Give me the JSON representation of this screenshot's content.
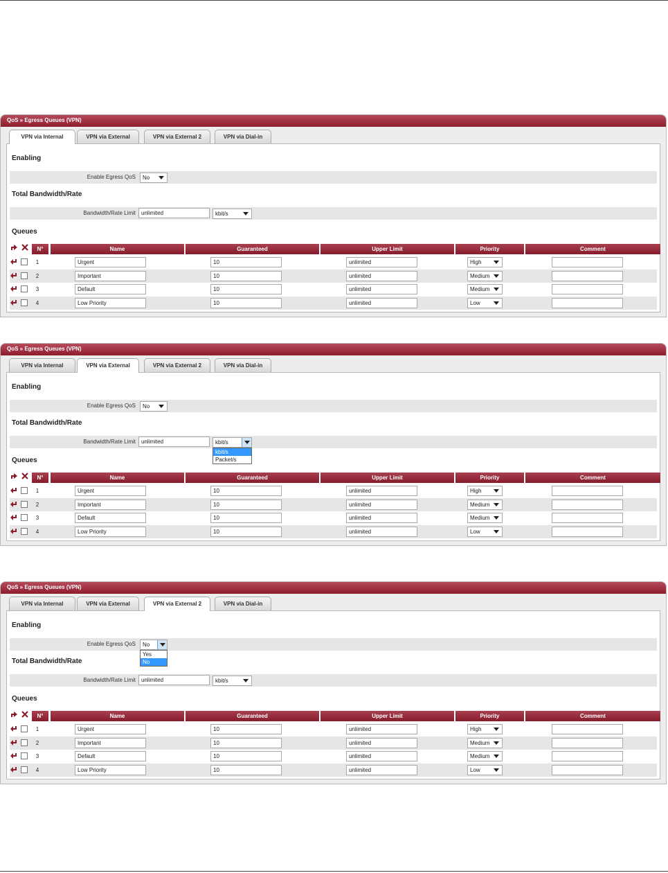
{
  "panels": [
    {
      "title": "QoS » Egress Queues (VPN)",
      "tabs": [
        "VPN via Internal",
        "VPN via External",
        "VPN via External 2",
        "VPN via Dial-in"
      ],
      "active_tab": 0,
      "sections": {
        "enabling": "Enabling",
        "bandwidth": "Total Bandwidth/Rate",
        "queues": "Queues"
      },
      "enable_label": "Enable Egress QoS",
      "enable_value": "No",
      "bandwidth_label": "Bandwidth/Rate Limit",
      "bandwidth_value": "unlimited",
      "unit_value": "kbit/s",
      "columns": [
        "N°",
        "Name",
        "Guaranteed",
        "Upper Limit",
        "Priority",
        "Comment"
      ],
      "rows": [
        {
          "n": "1",
          "name": "Urgent",
          "guaranteed": "10",
          "upper": "unlimited",
          "priority": "High",
          "comment": ""
        },
        {
          "n": "2",
          "name": "Important",
          "guaranteed": "10",
          "upper": "unlimited",
          "priority": "Medium",
          "comment": ""
        },
        {
          "n": "3",
          "name": "Default",
          "guaranteed": "10",
          "upper": "unlimited",
          "priority": "Medium",
          "comment": ""
        },
        {
          "n": "4",
          "name": "Low Priority",
          "guaranteed": "10",
          "upper": "unlimited",
          "priority": "Low",
          "comment": ""
        }
      ]
    },
    {
      "title": "QoS » Egress Queues (VPN)",
      "tabs": [
        "VPN via Internal",
        "VPN via External",
        "VPN via External 2",
        "VPN via Dial-in"
      ],
      "active_tab": 1,
      "sections": {
        "enabling": "Enabling",
        "bandwidth": "Total Bandwidth/Rate",
        "queues": "Queues"
      },
      "enable_label": "Enable Egress QoS",
      "enable_value": "No",
      "bandwidth_label": "Bandwidth/Rate Limit",
      "bandwidth_value": "unlimited",
      "unit_value": "kbit/s",
      "unit_options": [
        "kbit/s",
        "Packet/s"
      ],
      "unit_open": true,
      "columns": [
        "N°",
        "Name",
        "Guaranteed",
        "Upper Limit",
        "Priority",
        "Comment"
      ],
      "rows": [
        {
          "n": "1",
          "name": "Urgent",
          "guaranteed": "10",
          "upper": "unlimited",
          "priority": "High",
          "comment": ""
        },
        {
          "n": "2",
          "name": "Important",
          "guaranteed": "10",
          "upper": "unlimited",
          "priority": "Medium",
          "comment": ""
        },
        {
          "n": "3",
          "name": "Default",
          "guaranteed": "10",
          "upper": "unlimited",
          "priority": "Medium",
          "comment": ""
        },
        {
          "n": "4",
          "name": "Low Priority",
          "guaranteed": "10",
          "upper": "unlimited",
          "priority": "Low",
          "comment": ""
        }
      ]
    },
    {
      "title": "QoS » Egress Queues (VPN)",
      "tabs": [
        "VPN via Internal",
        "VPN via External",
        "VPN via External 2",
        "VPN via Dial-in"
      ],
      "active_tab": 2,
      "sections": {
        "enabling": "Enabling",
        "bandwidth": "Total Bandwidth/Rate",
        "queues": "Queues"
      },
      "enable_label": "Enable Egress QoS",
      "enable_value": "No",
      "enable_options": [
        "Yes",
        "No"
      ],
      "enable_open": true,
      "bandwidth_label": "Bandwidth/Rate Limit",
      "bandwidth_value": "unlimited",
      "unit_value": "kbit/s",
      "columns": [
        "N°",
        "Name",
        "Guaranteed",
        "Upper Limit",
        "Priority",
        "Comment"
      ],
      "rows": [
        {
          "n": "1",
          "name": "Urgent",
          "guaranteed": "10",
          "upper": "unlimited",
          "priority": "High",
          "comment": ""
        },
        {
          "n": "2",
          "name": "Important",
          "guaranteed": "10",
          "upper": "unlimited",
          "priority": "Medium",
          "comment": ""
        },
        {
          "n": "3",
          "name": "Default",
          "guaranteed": "10",
          "upper": "unlimited",
          "priority": "Medium",
          "comment": ""
        },
        {
          "n": "4",
          "name": "Low Priority",
          "guaranteed": "10",
          "upper": "unlimited",
          "priority": "Low",
          "comment": ""
        }
      ]
    }
  ]
}
